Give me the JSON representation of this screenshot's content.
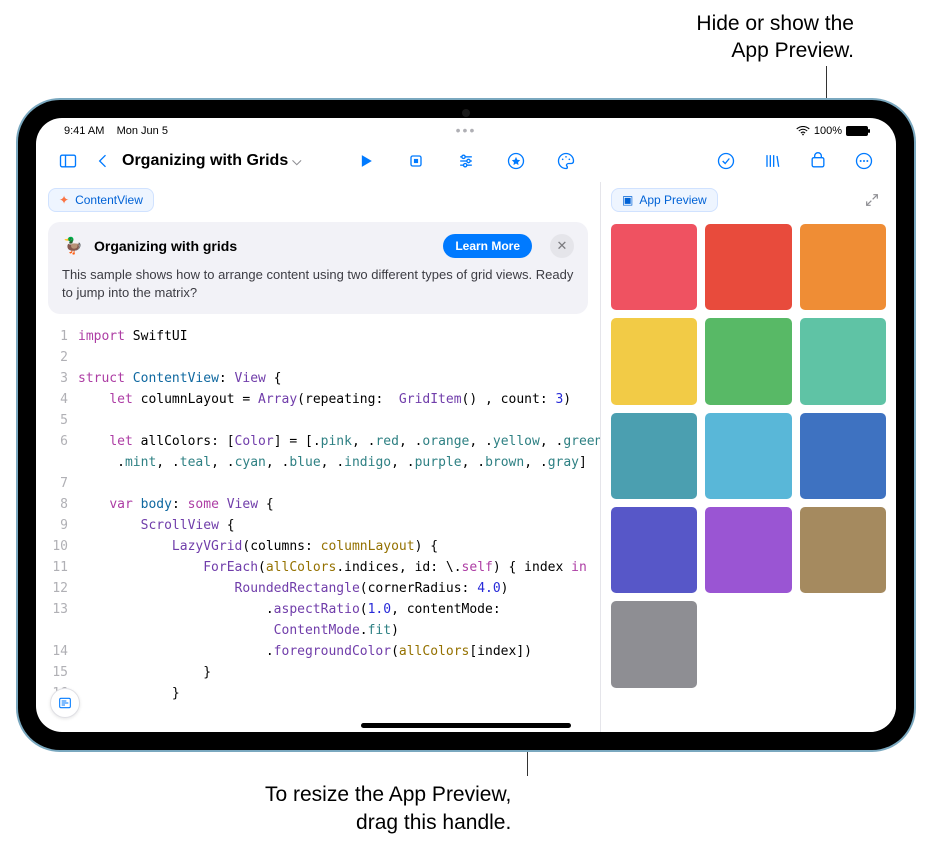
{
  "callouts": {
    "top": "Hide or show the\nApp Preview.",
    "bottom": "To resize the App Preview,\ndrag this handle."
  },
  "status": {
    "time": "9:41 AM",
    "date": "Mon Jun 5",
    "battery_pct": "100%"
  },
  "document": {
    "title": "Organizing with Grids"
  },
  "tabs": {
    "file": "ContentView",
    "preview": "App Preview"
  },
  "banner": {
    "title": "Organizing with grids",
    "desc": "This sample shows how to arrange content using two different types of grid views. Ready to jump into the matrix?",
    "learn_more": "Learn More"
  },
  "code": {
    "lines": [
      {
        "n": 1,
        "html": "<span class='kw'>import</span> SwiftUI"
      },
      {
        "n": 2,
        "html": ""
      },
      {
        "n": 3,
        "html": "<span class='kw'>struct</span> <span class='mc'>ContentView</span>: <span class='typ2'>View</span> {"
      },
      {
        "n": 4,
        "html": "    <span class='kw'>let</span> columnLayout = <span class='typ2'>Array</span>(repeating:  <span class='typ2'>GridItem</span>() , count: <span class='num'>3</span>)"
      },
      {
        "n": 5,
        "html": ""
      },
      {
        "n": 6,
        "html": "    <span class='kw'>let</span> allColors: [<span class='typ2'>Color</span>] = [.<span class='teal'>pink</span>, .<span class='teal'>red</span>, .<span class='teal'>orange</span>, .<span class='teal'>yellow</span>, .<span class='teal'>green</span>,\n     .<span class='teal'>mint</span>, .<span class='teal'>teal</span>, .<span class='teal'>cyan</span>, .<span class='teal'>blue</span>, .<span class='teal'>indigo</span>, .<span class='teal'>purple</span>, .<span class='teal'>brown</span>, .<span class='teal'>gray</span>]"
      },
      {
        "n": 7,
        "html": ""
      },
      {
        "n": 8,
        "html": "    <span class='kw'>var</span> <span class='mc'>body</span>: <span class='kw'>some</span> <span class='typ2'>View</span> {"
      },
      {
        "n": 9,
        "html": "        <span class='typ2'>ScrollView</span> {"
      },
      {
        "n": 10,
        "html": "            <span class='typ2'>LazyVGrid</span>(columns: <span class='prop'>columnLayout</span>) {"
      },
      {
        "n": 11,
        "html": "                <span class='typ2'>ForEach</span>(<span class='prop'>allColors</span>.indices, id: \\.<span class='kw'>self</span>) { index <span class='kw'>in</span>"
      },
      {
        "n": 12,
        "html": "                    <span class='typ2'>RoundedRectangle</span>(cornerRadius: <span class='num'>4.0</span>)"
      },
      {
        "n": 13,
        "html": "                        .<span class='fn'>aspectRatio</span>(<span class='num'>1.0</span>, contentMode:\n                         <span class='typ2'>ContentMode</span>.<span class='teal'>fit</span>)"
      },
      {
        "n": 14,
        "html": "                        .<span class='fn'>foregroundColor</span>(<span class='prop'>allColors</span>[index])"
      },
      {
        "n": 15,
        "html": "                }"
      },
      {
        "n": 16,
        "html": "            }"
      }
    ]
  },
  "preview_colors": [
    "#ef5261",
    "#e84b3c",
    "#ef8d35",
    "#f2cb46",
    "#58b966",
    "#5fc3a5",
    "#4b9fb0",
    "#59b7d8",
    "#3e72c1",
    "#5757c8",
    "#9a55d3",
    "#a58a5f",
    "#8e8e93"
  ]
}
